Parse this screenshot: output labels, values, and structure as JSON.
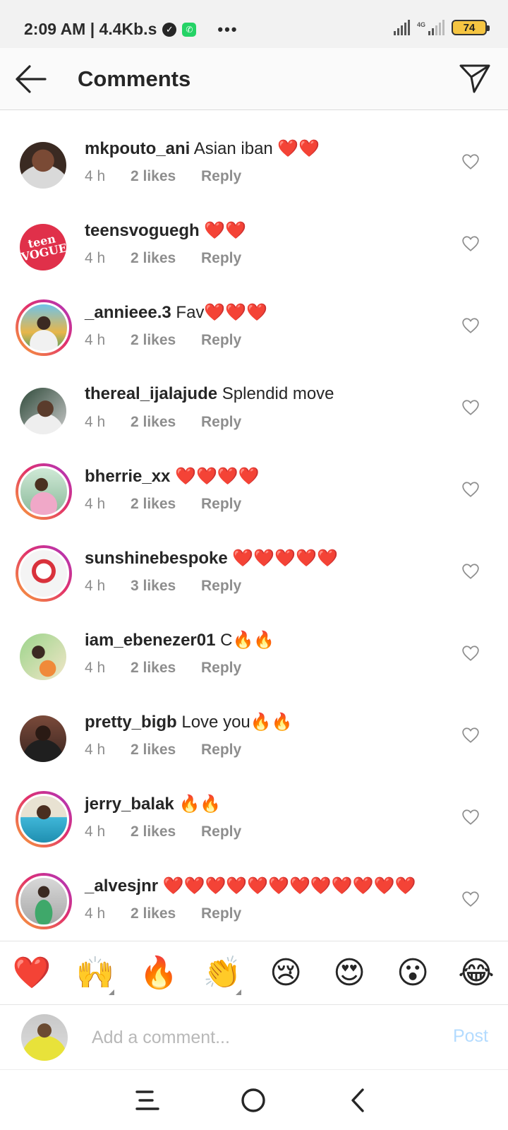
{
  "status_bar": {
    "time_speed": "2:09 AM | 4.4Kb.s",
    "dots": "•••",
    "network_label": "4G",
    "battery": "74"
  },
  "header": {
    "title": "Comments"
  },
  "comments": [
    {
      "username": "mkpouto_ani",
      "text": "Asian iban ❤️❤️",
      "time": "4 h",
      "likes": "2 likes",
      "reply": "Reply"
    },
    {
      "username": "teensvoguegh",
      "text": "❤️❤️",
      "time": "4 h",
      "likes": "2 likes",
      "reply": "Reply"
    },
    {
      "username": "_annieee.3",
      "text": "Fav❤️❤️❤️",
      "time": "4 h",
      "likes": "2 likes",
      "reply": "Reply"
    },
    {
      "username": "thereal_ijalajude",
      "text": "Splendid move",
      "time": "4 h",
      "likes": "2 likes",
      "reply": "Reply"
    },
    {
      "username": "bherrie_xx",
      "text": "❤️❤️❤️❤️",
      "time": "4 h",
      "likes": "2 likes",
      "reply": "Reply"
    },
    {
      "username": "sunshinebespoke",
      "text": "❤️❤️❤️❤️❤️",
      "time": "4 h",
      "likes": "3 likes",
      "reply": "Reply"
    },
    {
      "username": "iam_ebenezer01",
      "text": "C🔥🔥",
      "time": "4 h",
      "likes": "2 likes",
      "reply": "Reply"
    },
    {
      "username": "pretty_bigb",
      "text": "Love you🔥🔥",
      "time": "4 h",
      "likes": "2 likes",
      "reply": "Reply"
    },
    {
      "username": "jerry_balak",
      "text": "🔥🔥",
      "time": "4 h",
      "likes": "2 likes",
      "reply": "Reply"
    },
    {
      "username": "_alvesjnr",
      "text": "❤️❤️❤️❤️❤️❤️❤️❤️❤️❤️❤️❤️",
      "time": "4 h",
      "likes": "2 likes",
      "reply": "Reply"
    }
  ],
  "emoji_bar": [
    "❤️",
    "🙌",
    "🔥",
    "👏",
    "😢",
    "😍",
    "😮",
    "😂"
  ],
  "input": {
    "placeholder": "Add a comment...",
    "post_label": "Post"
  },
  "icons": {
    "back": "arrow-left-icon",
    "send": "paper-plane-icon",
    "like": "heart-outline-icon",
    "nav_menu": "menu-icon",
    "nav_home": "home-circle-icon",
    "nav_back": "chevron-left-icon"
  },
  "colors": {
    "post_disabled": "#b3dbff",
    "meta_gray": "#8e8e8e",
    "story_ring": "#e1306c"
  }
}
